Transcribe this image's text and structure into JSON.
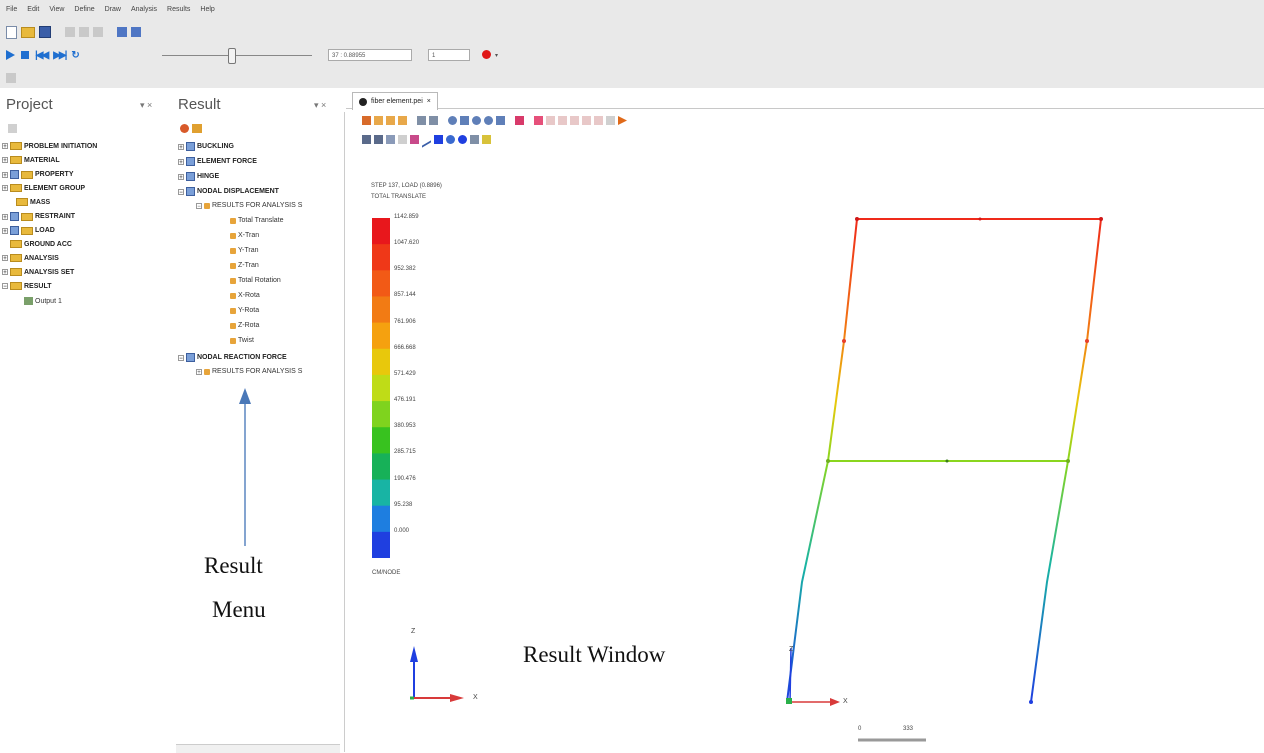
{
  "menu": [
    "File",
    "Edit",
    "View",
    "Define",
    "Draw",
    "Analysis",
    "Results",
    "Help"
  ],
  "toolbar": {
    "step_value": "37 : 0.88955",
    "speed_value": "1"
  },
  "project_panel": {
    "title": "Project",
    "pin": "▾ ×",
    "items": [
      {
        "label": "PROBLEM INITIATION"
      },
      {
        "label": "MATERIAL"
      },
      {
        "label": "PROPERTY"
      },
      {
        "label": "ELEMENT GROUP"
      },
      {
        "label": "MASS"
      },
      {
        "label": "RESTRAINT"
      },
      {
        "label": "LOAD"
      },
      {
        "label": "GROUND ACC"
      },
      {
        "label": "ANALYSIS"
      },
      {
        "label": "ANALYSIS SET"
      },
      {
        "label": "RESULT"
      },
      {
        "label": "Output 1"
      }
    ]
  },
  "result_panel": {
    "title": "Result",
    "pin": "▾ ×",
    "items": [
      {
        "label": "BUCKLING"
      },
      {
        "label": "ELEMENT FORCE"
      },
      {
        "label": "HINGE"
      },
      {
        "label": "NODAL DISPLACEMENT"
      },
      {
        "label": "RESULTS FOR ANALYSIS S"
      },
      {
        "label": "Total Translate"
      },
      {
        "label": "X-Tran"
      },
      {
        "label": "Y-Tran"
      },
      {
        "label": "Z-Tran"
      },
      {
        "label": "Total Rotation"
      },
      {
        "label": "X-Rota"
      },
      {
        "label": "Y-Rota"
      },
      {
        "label": "Z-Rota"
      },
      {
        "label": "Twist"
      },
      {
        "label": "NODAL REACTION FORCE"
      },
      {
        "label": "RESULTS FOR ANALYSIS S"
      }
    ]
  },
  "document": {
    "tab_label": "fiber element.pei",
    "tab_close": "×"
  },
  "legend": {
    "title_line1": "STEP 137, LOAD (0.8896)",
    "title_line2": "TOTAL TRANSLATE",
    "values": [
      "1142.859",
      "1047.620",
      "952.382",
      "857.144",
      "761.906",
      "666.668",
      "571.429",
      "476.191",
      "380.953",
      "285.715",
      "190.476",
      "95.238",
      "0.000"
    ],
    "footer": "CM/NODE",
    "colors": [
      "#e8171c",
      "#ef3818",
      "#f25a16",
      "#f27b14",
      "#f5a10f",
      "#e8c80c",
      "#bfdc17",
      "#7fd31e",
      "#38c21f",
      "#17b158",
      "#18b4a4",
      "#1e7ee0",
      "#1f3fe0"
    ]
  },
  "axis_labels": {
    "z": "Z",
    "x": "X"
  },
  "annotations": {
    "result_menu_line1": "Result",
    "result_menu_line2": "Menu",
    "result_window": "Result Window"
  },
  "scale_bar": {
    "left": "0",
    "right": "333"
  }
}
